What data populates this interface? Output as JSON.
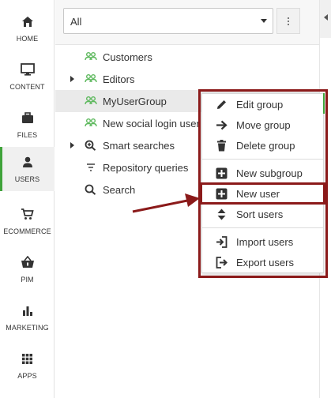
{
  "sidebar": {
    "items": [
      {
        "label": "HOME",
        "icon": "home-icon"
      },
      {
        "label": "CONTENT",
        "icon": "monitor-icon"
      },
      {
        "label": "FILES",
        "icon": "briefcase-icon"
      },
      {
        "label": "USERS",
        "icon": "user-icon",
        "active": true
      },
      {
        "label": "ECOMMERCE",
        "icon": "cart-icon"
      },
      {
        "label": "PIM",
        "icon": "basket-icon"
      },
      {
        "label": "MARKETING",
        "icon": "bar-chart-icon"
      },
      {
        "label": "APPS",
        "icon": "grid-icon"
      }
    ]
  },
  "filter": {
    "value": "All"
  },
  "tree": {
    "items": [
      {
        "label": "Customers",
        "icon": "user-group-icon"
      },
      {
        "label": "Editors",
        "icon": "user-group-icon",
        "expandable": true
      },
      {
        "label": "MyUserGroup",
        "icon": "user-group-icon",
        "selected": true
      },
      {
        "label": "New social login user",
        "icon": "user-group-icon"
      },
      {
        "label": "Smart searches",
        "icon": "search-plus-icon",
        "expandable": true
      },
      {
        "label": "Repository queries",
        "icon": "filter-icon"
      },
      {
        "label": "Search",
        "icon": "search-icon"
      }
    ]
  },
  "context_menu": {
    "items": [
      {
        "label": "Edit group",
        "icon": "pencil-icon"
      },
      {
        "label": "Move group",
        "icon": "arrow-right-icon"
      },
      {
        "label": "Delete group",
        "icon": "trash-icon"
      },
      {
        "label": "New subgroup",
        "icon": "plus-square-icon"
      },
      {
        "label": "New user",
        "icon": "plus-square-icon",
        "highlighted": true
      },
      {
        "label": "Sort users",
        "icon": "sort-icon"
      },
      {
        "label": "Import users",
        "icon": "sign-in-icon"
      },
      {
        "label": "Export users",
        "icon": "sign-out-icon"
      }
    ]
  },
  "colors": {
    "accent_green": "#3fa33a",
    "annotation_red": "#8b1a1a",
    "selected_row": "#eaeaea"
  }
}
